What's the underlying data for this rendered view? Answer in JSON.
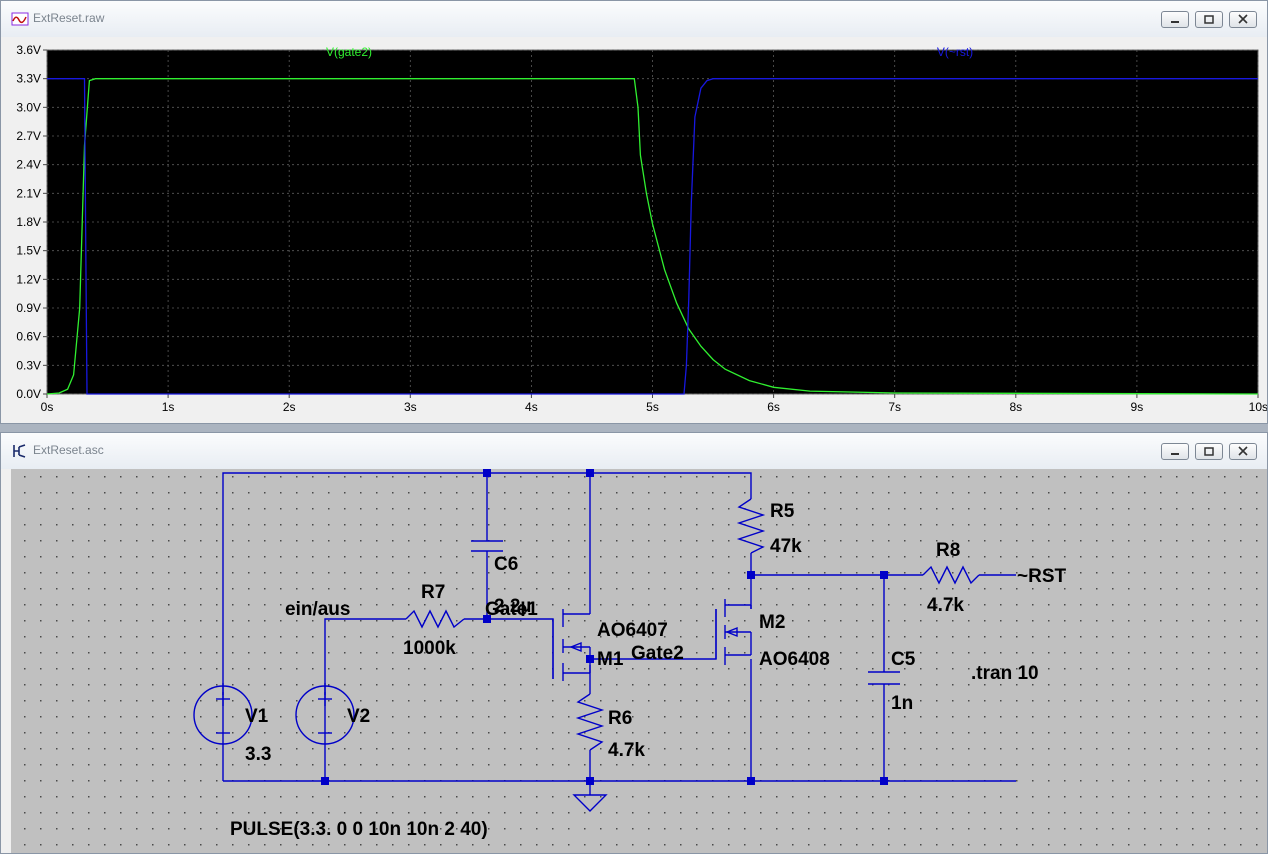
{
  "waveform_window": {
    "title": "ExtReset.raw",
    "controls": [
      "minimize",
      "restore",
      "close"
    ]
  },
  "schematic_window": {
    "title": "ExtReset.asc",
    "controls": [
      "minimize",
      "restore",
      "close"
    ]
  },
  "chart_data": {
    "type": "line",
    "title": "",
    "xlabel": "",
    "ylabel": "",
    "xlim": [
      0,
      10
    ],
    "ylim": [
      0,
      3.6
    ],
    "x_ticks": [
      "0s",
      "1s",
      "2s",
      "3s",
      "4s",
      "5s",
      "6s",
      "7s",
      "8s",
      "9s",
      "10s"
    ],
    "y_ticks": [
      "0.0V",
      "0.3V",
      "0.6V",
      "0.9V",
      "1.2V",
      "1.5V",
      "1.8V",
      "2.1V",
      "2.4V",
      "2.7V",
      "3.0V",
      "3.3V",
      "3.6V"
    ],
    "background": "#000000",
    "grid": true,
    "series": [
      {
        "name": "V(gate2)",
        "color": "#30f030",
        "x": [
          0,
          0.1,
          0.17,
          0.22,
          0.27,
          0.31,
          0.35,
          0.4,
          1.0,
          1.76,
          2.5,
          3.6,
          4.1,
          4.85,
          4.88,
          4.9,
          4.95,
          5.0,
          5.1,
          5.2,
          5.3,
          5.4,
          5.5,
          5.6,
          5.8,
          6.0,
          6.3,
          7.0,
          10
        ],
        "values": [
          0,
          0.01,
          0.05,
          0.2,
          0.9,
          2.6,
          3.28,
          3.3,
          3.3,
          3.3,
          3.3,
          3.3,
          3.3,
          3.3,
          3.0,
          2.5,
          2.1,
          1.78,
          1.3,
          0.95,
          0.68,
          0.5,
          0.36,
          0.26,
          0.14,
          0.07,
          0.03,
          0.01,
          0.0
        ]
      },
      {
        "name": "V(~rst)",
        "color": "#1818e0",
        "x": [
          0,
          0.31,
          0.32,
          0.33,
          5.26,
          5.28,
          5.3,
          5.32,
          5.35,
          5.4,
          5.45,
          5.5,
          10
        ],
        "values": [
          3.3,
          3.3,
          1.5,
          0,
          0,
          0.3,
          1.0,
          2.0,
          2.9,
          3.2,
          3.28,
          3.3,
          3.3
        ]
      }
    ]
  },
  "schematic": {
    "components": [
      {
        "ref": "V1",
        "value": "3.3"
      },
      {
        "ref": "V2",
        "value": ""
      },
      {
        "ref": "C6",
        "value": "2.2µ"
      },
      {
        "ref": "R7",
        "value": "1000k"
      },
      {
        "ref": "M1",
        "value": "AO6407"
      },
      {
        "ref": "M2",
        "value": "AO6408"
      },
      {
        "ref": "R5",
        "value": "47k"
      },
      {
        "ref": "R6",
        "value": "4.7k"
      },
      {
        "ref": "R8",
        "value": "4.7k"
      },
      {
        "ref": "C5",
        "value": "1n"
      }
    ],
    "net_labels": {
      "ein_aus": "ein/aus",
      "gate1": "Gate1",
      "gate2": "Gate2",
      "rst": "~RST"
    },
    "directive": ".tran 10",
    "v2_pulse": "PULSE(3.3. 0 0 10n 10n 2 40)",
    "wire_color": "#0000c8",
    "background": "#c0c0c0"
  }
}
